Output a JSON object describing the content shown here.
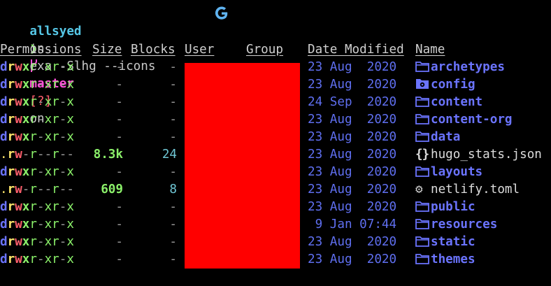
{
  "prompt": {
    "user": "allsyed",
    "on1": "on",
    "branch_icon": "git-branch-icon",
    "branch": "master",
    "status": "[?]",
    "on2": "on",
    "context_icon": "google-cloud-icon",
    "arrow": "❯",
    "command": "exa -Slhg --icons"
  },
  "headers": {
    "permissions": "Permissions",
    "size": "Size",
    "blocks": "Blocks",
    "user": "User",
    "group": "Group",
    "date": "Date Modified",
    "name": "Name"
  },
  "rows": [
    {
      "perm": "drwxr-xr-x",
      "size": "-",
      "blocks": "-",
      "date": "23 Aug  2020",
      "icon": "folder-icon",
      "name": "archetypes",
      "type": "dir"
    },
    {
      "perm": "drwxr-xr-x",
      "size": "-",
      "blocks": "-",
      "date": "23 Aug  2020",
      "icon": "config-folder-icon",
      "name": "config",
      "type": "dir"
    },
    {
      "perm": "drwxr-xr-x",
      "size": "-",
      "blocks": "-",
      "date": "24 Sep  2020",
      "icon": "folder-icon",
      "name": "content",
      "type": "dir"
    },
    {
      "perm": "drwxr-xr-x",
      "size": "-",
      "blocks": "-",
      "date": "23 Aug  2020",
      "icon": "folder-icon",
      "name": "content-org",
      "type": "dir"
    },
    {
      "perm": "drwxr-xr-x",
      "size": "-",
      "blocks": "-",
      "date": "23 Aug  2020",
      "icon": "folder-icon",
      "name": "data",
      "type": "dir"
    },
    {
      "perm": ".rw-r--r--",
      "size": "8.3k",
      "blocks": "24",
      "date": "23 Aug  2020",
      "icon": "json-icon",
      "name": "hugo_stats.json",
      "type": "file"
    },
    {
      "perm": "drwxr-xr-x",
      "size": "-",
      "blocks": "-",
      "date": "23 Aug  2020",
      "icon": "folder-icon",
      "name": "layouts",
      "type": "dir"
    },
    {
      "perm": ".rw-r--r--",
      "size": "609",
      "blocks": "8",
      "date": "23 Aug  2020",
      "icon": "gear-icon",
      "name": "netlify.toml",
      "type": "file"
    },
    {
      "perm": "drwxr-xr-x",
      "size": "-",
      "blocks": "-",
      "date": "23 Aug  2020",
      "icon": "folder-icon",
      "name": "public",
      "type": "dir"
    },
    {
      "perm": "drwxr-xr-x",
      "size": "-",
      "blocks": "-",
      "date": " 9 Jan 07:44",
      "icon": "folder-icon",
      "name": "resources",
      "type": "dir"
    },
    {
      "perm": "drwxr-xr-x",
      "size": "-",
      "blocks": "-",
      "date": "23 Aug  2020",
      "icon": "folder-icon",
      "name": "static",
      "type": "dir"
    },
    {
      "perm": "drwxr-xr-x",
      "size": "-",
      "blocks": "-",
      "date": "23 Aug  2020",
      "icon": "folder-icon",
      "name": "themes",
      "type": "dir"
    }
  ],
  "colors": {
    "background": "#000000",
    "redaction": "#ff0000",
    "directory": "#6b74ff",
    "date": "#5f6ff0"
  }
}
